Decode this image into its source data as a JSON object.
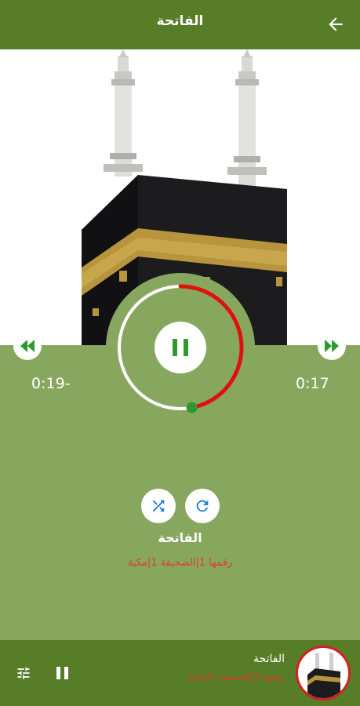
{
  "header": {
    "title": "الفاتحة",
    "back_icon": "arrow-back-icon"
  },
  "player": {
    "elapsed": "0:17",
    "remaining": "0:19-",
    "progress_fraction": 0.47,
    "state": "playing"
  },
  "track": {
    "name": "الفاتحة",
    "meta": "رقمها 1|الصحيفة 1|مكية"
  },
  "mini_player": {
    "name": "الفاتحة",
    "meta": "رقمها 1|الصحيفة 1|مكية"
  },
  "colors": {
    "header": "#577d28",
    "background": "#88a75e",
    "progress": "#e01010",
    "accent": "#2e9a2e",
    "meta_text": "#e03b2a"
  }
}
